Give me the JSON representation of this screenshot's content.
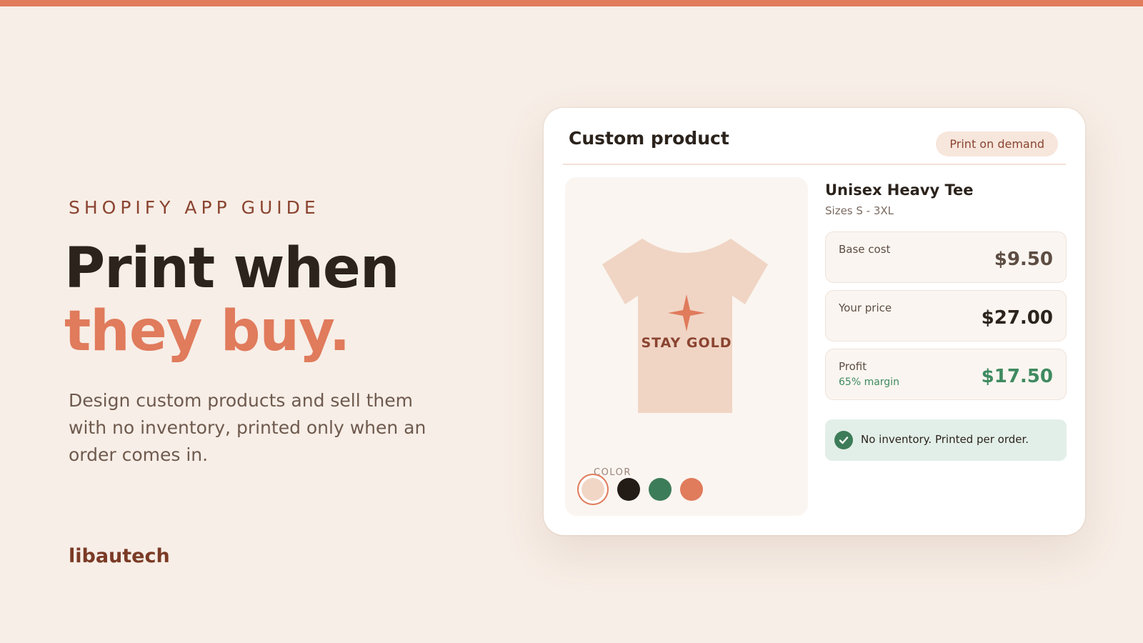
{
  "hero": {
    "eyebrow": "SHOPIFY APP GUIDE",
    "headline_line1": "Print when",
    "headline_line2": "they buy.",
    "description": "Design custom products and sell them with no inventory, printed only when an order comes in.",
    "brand": "libautech"
  },
  "card": {
    "title": "Custom product",
    "badge": "Print on demand",
    "preview": {
      "shirt_print": "STAY GOLD",
      "color_label": "COLOR",
      "swatches": [
        {
          "name": "peach",
          "color": "#f1d6c6",
          "selected": true
        },
        {
          "name": "black",
          "color": "#231c16",
          "selected": false
        },
        {
          "name": "green",
          "color": "#3d7c59",
          "selected": false
        },
        {
          "name": "coral",
          "color": "#e07b5c",
          "selected": false
        }
      ]
    },
    "product": {
      "name": "Unisex Heavy Tee",
      "sizes": "Sizes S - 3XL"
    },
    "prices": [
      {
        "label": "Base cost",
        "value": "$9.50"
      },
      {
        "label": "Your price",
        "value": "$27.00"
      },
      {
        "label": "Profit",
        "sub": "65% margin",
        "value": "$17.50"
      }
    ],
    "notice": "No inventory. Printed per order."
  },
  "colors": {
    "accent": "#e07b5c",
    "background": "#f7eee7",
    "success": "#3d7c59"
  }
}
